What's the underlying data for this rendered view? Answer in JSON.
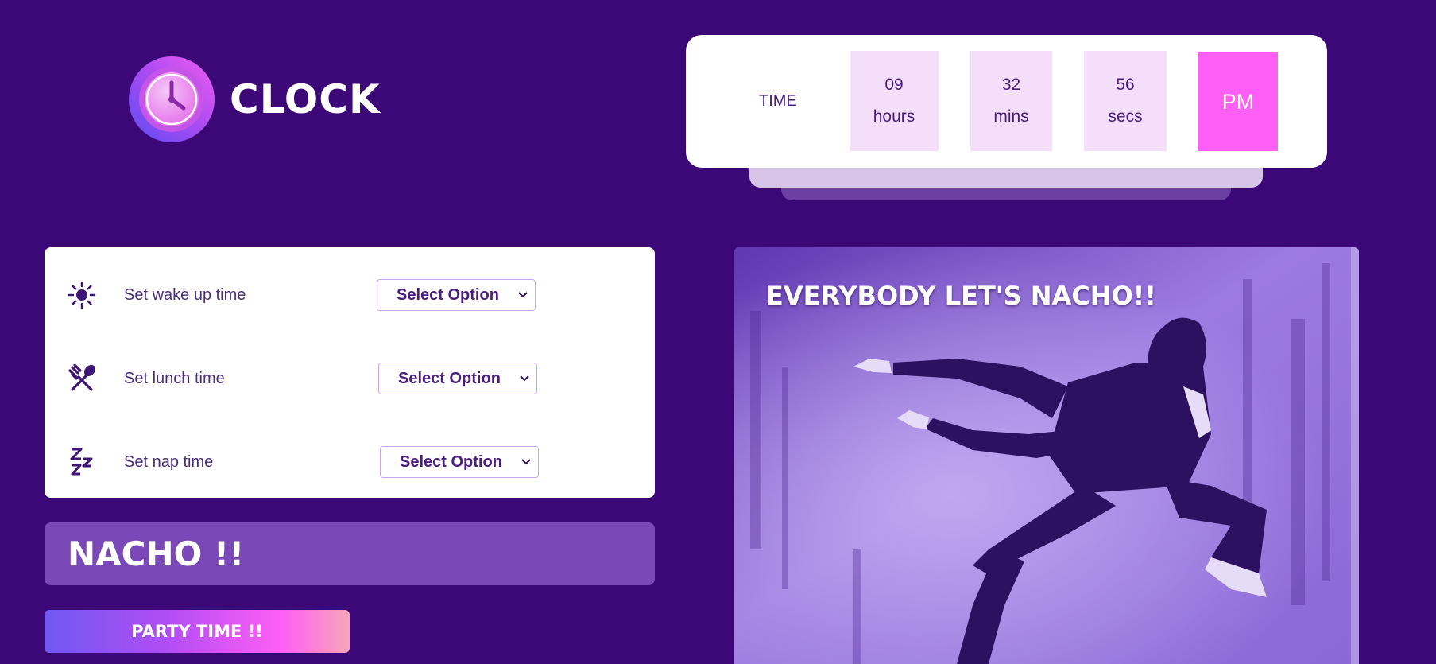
{
  "logo": {
    "title": "CLOCK",
    "icon": "clock-icon"
  },
  "time": {
    "label": "TIME",
    "hours": {
      "value": "09",
      "unit": "hours"
    },
    "mins": {
      "value": "32",
      "unit": "mins"
    },
    "secs": {
      "value": "56",
      "unit": "secs"
    },
    "ampm": "PM"
  },
  "settings": [
    {
      "icon": "sun-icon",
      "label": "Set wake up time",
      "selected": "Select Option"
    },
    {
      "icon": "fork-spoon-icon",
      "label": "Set lunch time",
      "selected": "Select Option"
    },
    {
      "icon": "zzz-icon",
      "label": "Set nap time",
      "selected": "Select Option"
    }
  ],
  "banner": {
    "text": "NACHO !!"
  },
  "button": {
    "label": "PARTY TIME !!"
  },
  "image": {
    "caption": "EVERYBODY LET'S NACHO!!"
  },
  "colors": {
    "background": "#3c0878",
    "accent_pink": "#ff5ff5",
    "card": "#ffffff",
    "time_box": "#f5defa",
    "banner": "#7b48b7",
    "text_purple": "#4a1d7e"
  }
}
